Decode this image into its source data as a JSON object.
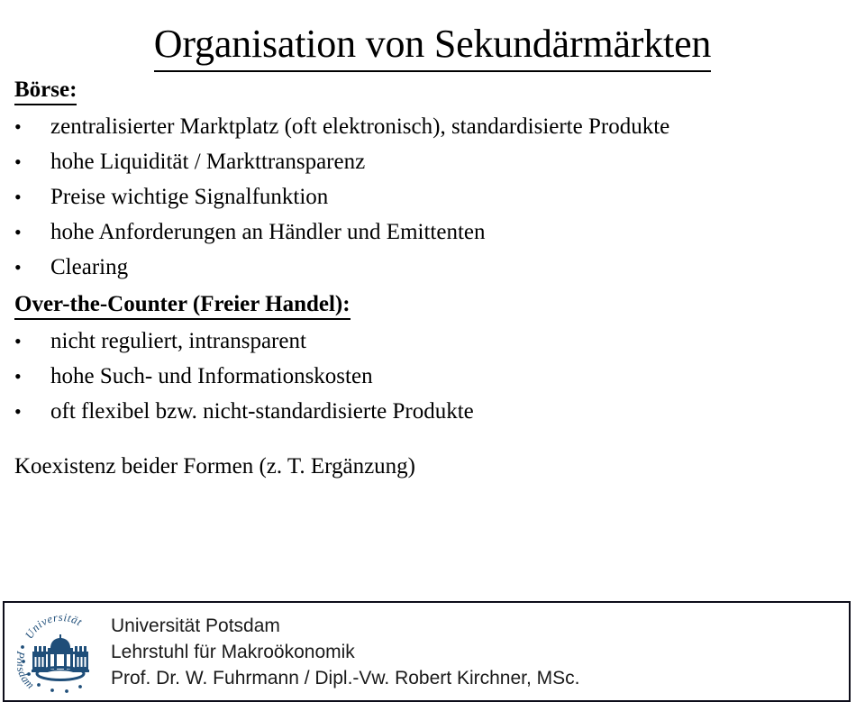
{
  "slide": {
    "title": "Organisation von Sekundärmärkten",
    "sections": [
      {
        "heading": "Börse:",
        "bullet_glyph": "•",
        "bullets": [
          "zentralisierter Marktplatz (oft elektronisch), standardisierte Produkte",
          "hohe Liquidität / Markttransparenz",
          "Preise wichtige Signalfunktion",
          "hohe Anforderungen an Händler und Emittenten",
          "Clearing"
        ]
      },
      {
        "heading": "Over-the-Counter (Freier Handel):",
        "bullet_glyph": "•",
        "bullets": [
          "nicht reguliert, intransparent",
          "hohe Such- und Informationskosten",
          "oft flexibel bzw. nicht-standardisierte Produkte"
        ]
      }
    ],
    "closing_line": "Koexistenz beider Formen (z. T. Ergänzung)"
  },
  "footer": {
    "logo": {
      "arc_top_text": "Universität",
      "arc_bottom_text": "Potsdam",
      "color": "#1F4E79"
    },
    "lines": [
      "Universität Potsdam",
      "Lehrstuhl für Makroökonomik",
      "Prof. Dr. W. Fuhrmann / Dipl.-Vw. Robert Kirchner, MSc."
    ]
  },
  "colors": {
    "text": "#000000",
    "logo_blue": "#1F4E79",
    "footer_border": "#0d0d1a",
    "background": "#ffffff"
  }
}
